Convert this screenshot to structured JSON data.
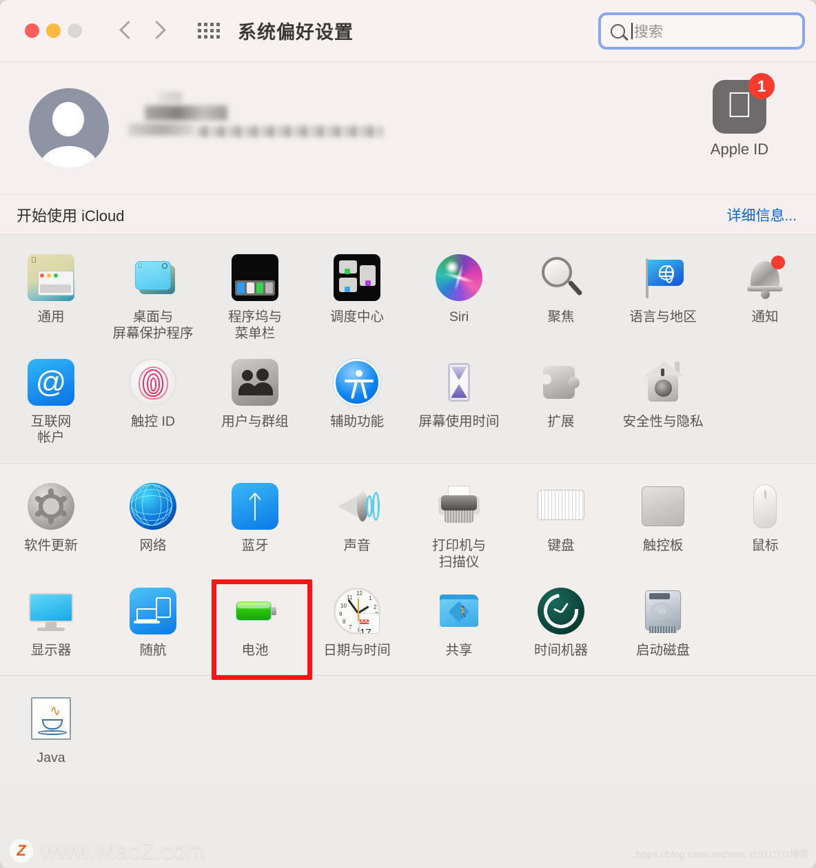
{
  "window": {
    "title": "系统偏好设置",
    "traffic_lights": [
      "close",
      "minimize",
      "zoom"
    ],
    "grid_icon": "app-grid-icon",
    "nav": {
      "back": "back-chevron",
      "forward": "forward-chevron"
    }
  },
  "search": {
    "placeholder": "搜索",
    "value": "",
    "icon": "search-icon",
    "focused": true,
    "focus_ring_color": "#8aa6f0"
  },
  "account": {
    "avatar": "default-user-avatar",
    "name_redacted": true,
    "name": "",
    "subtitle": "",
    "apple_id": {
      "label": "Apple ID",
      "icon": "apple-logo-icon",
      "badge_count": "1",
      "badge_color": "#f93c2e"
    }
  },
  "icloud": {
    "text": "开始使用 iCloud",
    "link": "详细信息...",
    "link_color": "#0a63d6"
  },
  "sections": [
    {
      "name": "personal",
      "items": [
        {
          "label": "通用",
          "icon": "general-icon"
        },
        {
          "label": "桌面与\n屏幕保护程序",
          "icon": "desktop-screensaver-icon"
        },
        {
          "label": "程序坞与\n菜单栏",
          "icon": "dock-menubar-icon"
        },
        {
          "label": "调度中心",
          "icon": "mission-control-icon"
        },
        {
          "label": "Siri",
          "icon": "siri-icon"
        },
        {
          "label": "聚焦",
          "icon": "spotlight-icon"
        },
        {
          "label": "语言与地区",
          "icon": "language-region-icon"
        },
        {
          "label": "通知",
          "icon": "notifications-icon",
          "badge": true
        },
        {
          "label": "互联网\n帐户",
          "icon": "internet-accounts-icon"
        },
        {
          "label": "触控 ID",
          "icon": "touch-id-icon"
        },
        {
          "label": "用户与群组",
          "icon": "users-groups-icon"
        },
        {
          "label": "辅助功能",
          "icon": "accessibility-icon"
        },
        {
          "label": "屏幕使用时间",
          "icon": "screen-time-icon"
        },
        {
          "label": "扩展",
          "icon": "extensions-icon"
        },
        {
          "label": "安全性与隐私",
          "icon": "security-privacy-icon"
        }
      ]
    },
    {
      "name": "hardware",
      "items": [
        {
          "label": "软件更新",
          "icon": "software-update-icon"
        },
        {
          "label": "网络",
          "icon": "network-icon"
        },
        {
          "label": "蓝牙",
          "icon": "bluetooth-icon"
        },
        {
          "label": "声音",
          "icon": "sound-icon"
        },
        {
          "label": "打印机与\n扫描仪",
          "icon": "printers-scanners-icon"
        },
        {
          "label": "键盘",
          "icon": "keyboard-icon"
        },
        {
          "label": "触控板",
          "icon": "trackpad-icon"
        },
        {
          "label": "鼠标",
          "icon": "mouse-icon"
        },
        {
          "label": "显示器",
          "icon": "displays-icon"
        },
        {
          "label": "随航",
          "icon": "sidecar-icon"
        },
        {
          "label": "电池",
          "icon": "battery-icon",
          "highlighted": true
        },
        {
          "label": "日期与时间",
          "icon": "date-time-icon",
          "calendar_month": "JUL",
          "calendar_day": "17"
        },
        {
          "label": "共享",
          "icon": "sharing-icon"
        },
        {
          "label": "时间机器",
          "icon": "time-machine-icon"
        },
        {
          "label": "启动磁盘",
          "icon": "startup-disk-icon"
        }
      ]
    },
    {
      "name": "other",
      "items": [
        {
          "label": "Java",
          "icon": "java-icon"
        }
      ]
    }
  ],
  "watermarks": {
    "left_badge": "Z",
    "left_text": "www.MacZ.com",
    "right_text": "https://blog.csdn.net/mac",
    "right_text2": "@51CTO博客"
  },
  "highlight": {
    "color": "#fd1414",
    "target": "电池"
  }
}
